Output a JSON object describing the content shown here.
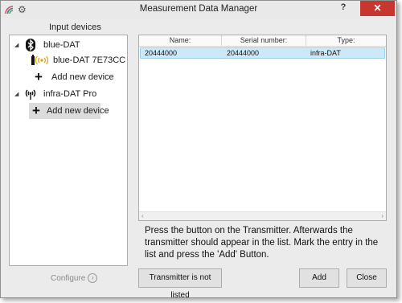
{
  "window": {
    "title": "Measurement Data Manager",
    "help_label": "?",
    "close_label": "✕"
  },
  "left_panel": {
    "header": "Input devices",
    "tree": [
      {
        "label": "blue-DAT",
        "icon": "bluetooth-icon",
        "expanded": true
      },
      {
        "label": "blue-DAT 7E73CC",
        "icon": "wireless-device-icon"
      },
      {
        "label": "Add new device",
        "icon": "plus-icon"
      },
      {
        "label": "infra-DAT Pro",
        "icon": "antenna-icon",
        "expanded": true
      },
      {
        "label": "Add new device",
        "icon": "plus-icon",
        "selected": true
      }
    ],
    "configure_label": "Configure"
  },
  "table": {
    "columns": [
      "Name:",
      "Serial number:",
      "Type:"
    ],
    "rows": [
      {
        "name": "20444000",
        "serial": "20444000",
        "type": "infra-DAT"
      }
    ]
  },
  "instructions": "Press the button on the Transmitter. Afterwards the transmitter should appear in the list. Mark the entry in the list and press the 'Add' Button.",
  "buttons": {
    "not_listed": "Transmitter is not listed",
    "add": "Add",
    "close": "Close"
  },
  "colors": {
    "selection": "#cde8f7",
    "close_button": "#c7372f",
    "window_bg": "#ebebeb"
  }
}
